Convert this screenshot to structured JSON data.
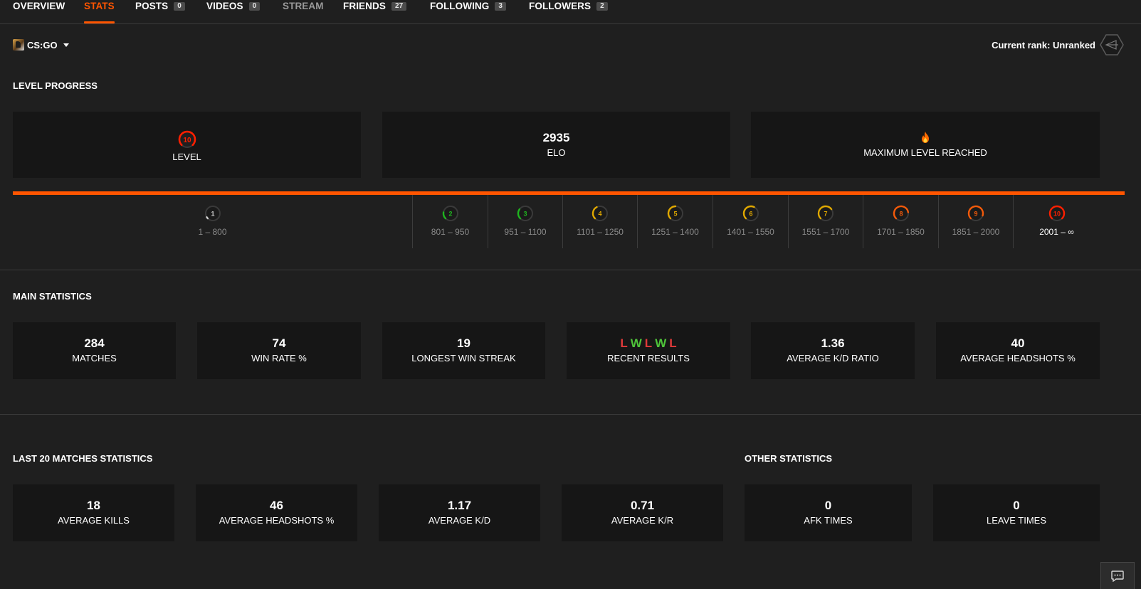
{
  "nav": {
    "items": [
      {
        "label": "OVERVIEW"
      },
      {
        "label": "STATS"
      },
      {
        "label": "POSTS",
        "badge": "0"
      },
      {
        "label": "VIDEOS",
        "badge": "0"
      },
      {
        "label": "STREAM"
      },
      {
        "label": "FRIENDS",
        "badge": "27"
      },
      {
        "label": "FOLLOWING",
        "badge": "3"
      },
      {
        "label": "FOLLOWERS",
        "badge": "2"
      }
    ],
    "active": "STATS"
  },
  "game_select": {
    "label": "CS:GO",
    "icon": "csgo-icon"
  },
  "rank": {
    "text": "Current rank: Unranked",
    "icon": "rank-hexagon-icon"
  },
  "level_progress": {
    "title": "LEVEL PROGRESS",
    "level": {
      "value": "10",
      "label": "LEVEL"
    },
    "elo": {
      "value": "2935",
      "label": "ELO"
    },
    "max": {
      "icon": "fire-icon",
      "label": "MAXIMUM LEVEL REACHED"
    },
    "progress_fraction": 1.0,
    "levels": [
      {
        "level": "1",
        "range": "1 – 800",
        "color": "#d0d0d0",
        "fill": 0.05
      },
      {
        "level": "2",
        "range": "801 – 950",
        "color": "#1fb51f",
        "fill": 0.2
      },
      {
        "level": "3",
        "range": "951 – 1100",
        "color": "#1fb51f",
        "fill": 0.3
      },
      {
        "level": "4",
        "range": "1101 – 1250",
        "color": "#e0a800",
        "fill": 0.4
      },
      {
        "level": "5",
        "range": "1251 – 1400",
        "color": "#e0a800",
        "fill": 0.5
      },
      {
        "level": "6",
        "range": "1401 – 1550",
        "color": "#e0a800",
        "fill": 0.6
      },
      {
        "level": "7",
        "range": "1551 – 1700",
        "color": "#e0a800",
        "fill": 0.7
      },
      {
        "level": "8",
        "range": "1701 – 1850",
        "color": "#f25a0a",
        "fill": 0.8
      },
      {
        "level": "9",
        "range": "1851 – 2000",
        "color": "#f25a0a",
        "fill": 0.9
      },
      {
        "level": "10",
        "range": "2001 – ∞",
        "color": "#fe1f00",
        "fill": 1.0
      }
    ]
  },
  "main_statistics": {
    "title": "MAIN STATISTICS",
    "matches": {
      "value": "284",
      "label": "MATCHES"
    },
    "win_rate": {
      "value": "74",
      "label": "WIN RATE %"
    },
    "win_streak": {
      "value": "19",
      "label": "LONGEST WIN STREAK"
    },
    "recent_results": {
      "results": [
        "L",
        "W",
        "L",
        "W",
        "L"
      ],
      "label": "RECENT RESULTS"
    },
    "kd": {
      "value": "1.36",
      "label": "AVERAGE K/D RATIO"
    },
    "headshots": {
      "value": "40",
      "label": "AVERAGE HEADSHOTS %"
    }
  },
  "last20": {
    "title": "LAST 20 MATCHES STATISTICS",
    "kills": {
      "value": "18",
      "label": "AVERAGE KILLS"
    },
    "headshots": {
      "value": "46",
      "label": "AVERAGE HEADSHOTS %"
    },
    "kd": {
      "value": "1.17",
      "label": "AVERAGE K/D"
    },
    "kr": {
      "value": "0.71",
      "label": "AVERAGE K/R"
    }
  },
  "other": {
    "title": "OTHER STATISTICS",
    "afk": {
      "value": "0",
      "label": "AFK TIMES"
    },
    "leave": {
      "value": "0",
      "label": "LEAVE TIMES"
    }
  },
  "colors": {
    "accent": "#ff5500",
    "background": "#1f1f1f",
    "card": "#161616",
    "loss": "#e03a3a",
    "win": "#4fc43a"
  }
}
